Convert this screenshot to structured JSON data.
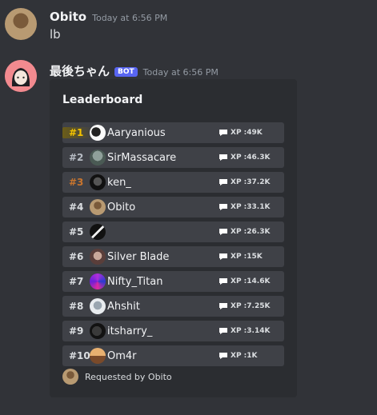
{
  "messages": [
    {
      "username": "Obito",
      "timestamp": "Today at 6:56 PM",
      "content": "lb"
    },
    {
      "username": "最後ちゃん",
      "badge": "BOT",
      "timestamp": "Today at 6:56 PM"
    }
  ],
  "embed": {
    "title": "Leaderboard",
    "rows": [
      {
        "rank": "#1",
        "name": "Aaryanious",
        "xp": "XP :49K"
      },
      {
        "rank": "#2",
        "name": "SirMassacare",
        "xp": "XP :46.3K"
      },
      {
        "rank": "#3",
        "name": "ken_",
        "xp": "XP :37.2K"
      },
      {
        "rank": "#4",
        "name": "Obito",
        "xp": "XP :33.1K"
      },
      {
        "rank": "#5",
        "name": "",
        "xp": "XP :26.3K"
      },
      {
        "rank": "#6",
        "name": "Silver Blade",
        "xp": "XP :15K"
      },
      {
        "rank": "#7",
        "name": "Nifty_Titan",
        "xp": "XP :14.6K"
      },
      {
        "rank": "#8",
        "name": "Ahshit",
        "xp": "XP :7.25K"
      },
      {
        "rank": "#9",
        "name": "itsharry_",
        "xp": "XP :3.14K"
      },
      {
        "rank": "#10",
        "name": "Om4r",
        "xp": "XP :1K"
      }
    ],
    "footer": "Requested by Obito"
  },
  "colors": {
    "background": "#313338",
    "embed": "#2b2d31",
    "row": "#3f4147",
    "bot_badge": "#5865f2",
    "rank_gold": "#f5c400",
    "rank_bronze": "#c8752e"
  },
  "icons": {
    "xp": "chat-bubble-icon"
  }
}
